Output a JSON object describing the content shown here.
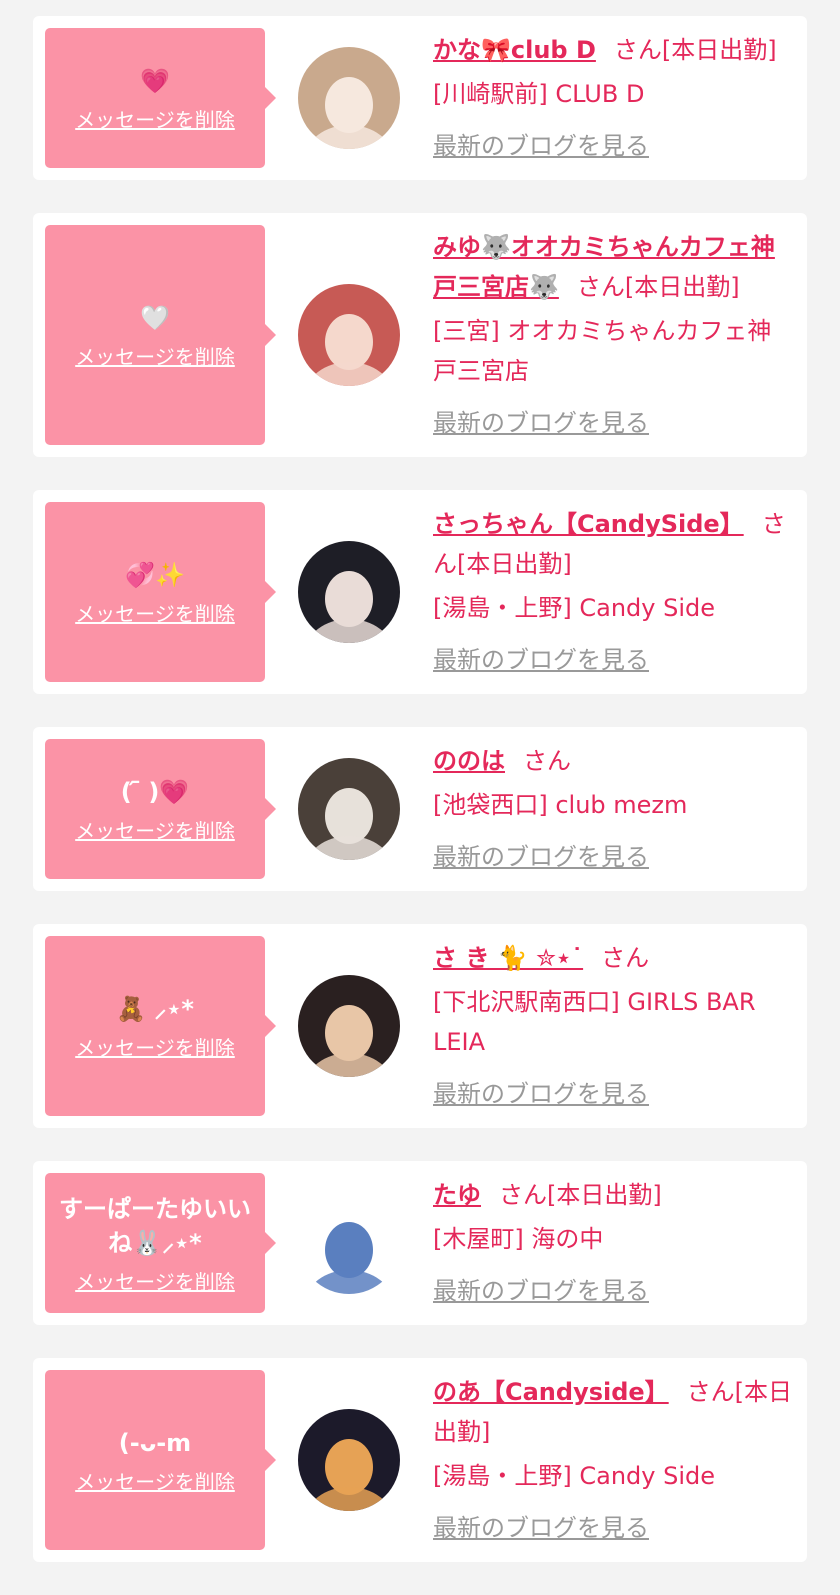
{
  "delete_label": "メッセージを削除",
  "blog_label": "最新のブログを見る",
  "cards": [
    {
      "message": "💗",
      "name": "かな🎀club D",
      "status": "さん[本日出勤]",
      "shop": "[川崎駅前] CLUB D",
      "avatar_colors": [
        "#c9a98d",
        "#f6e8de"
      ]
    },
    {
      "message": "🤍",
      "name": "みゆ🐺オオカミちゃんカフェ神戸三宮店🐺",
      "status": "さん[本日出勤]",
      "shop": "[三宮] オオカミちゃんカフェ神戸三宮店",
      "avatar_colors": [
        "#c75a55",
        "#f5d8cc"
      ]
    },
    {
      "message": "💞✨",
      "name": "さっちゃん【CandySide】",
      "status": "さん[本日出勤]",
      "shop": "[湯島・上野] Candy Side",
      "avatar_colors": [
        "#1e1e26",
        "#e9dcd7"
      ]
    },
    {
      "message": "( ᷇ )💗",
      "name": "ののは",
      "status": "さん",
      "shop": "[池袋西口] club mezm",
      "avatar_colors": [
        "#4a4039",
        "#e7e1da"
      ]
    },
    {
      "message": "🧸 ⸝⋆*",
      "name": "さ き 🐈 ✮⋆˙",
      "status": "さん",
      "shop": "[下北沢駅南西口] GIRLS BAR LEIA",
      "avatar_colors": [
        "#2a2020",
        "#e8c6a7"
      ]
    },
    {
      "message": "すーぱーたゆいいね🐰⸝⋆*",
      "name": "たゆ",
      "status": "さん[本日出勤]",
      "shop": "[木屋町] 海の中",
      "avatar_colors": [
        "#ffffff",
        "#5a7fbf"
      ]
    },
    {
      "message": "(-ᴗ-ⅿ",
      "name": "のあ【Candyside】",
      "status": "さん[本日出勤]",
      "shop": "[湯島・上野] Candy Side",
      "avatar_colors": [
        "#1c1a2a",
        "#e6a255"
      ]
    }
  ]
}
